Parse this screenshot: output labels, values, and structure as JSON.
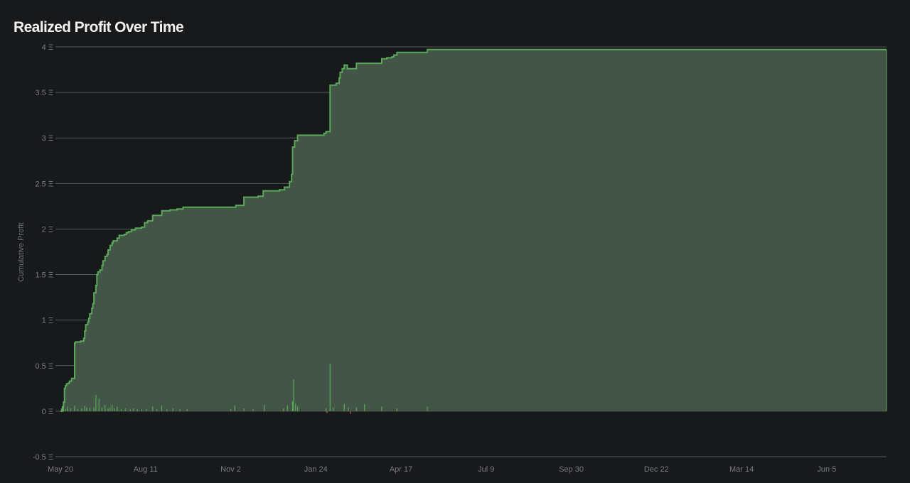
{
  "colors": {
    "background": "#18191b",
    "grid": "#55585c",
    "line": "#5aa85a",
    "area": "#435547",
    "negative": "#c25555"
  },
  "chart_data": {
    "type": "area",
    "title": "Realized Profit Over Time",
    "ylabel": "Cumulative Profit",
    "xlabel": "",
    "ylim": [
      -0.5,
      4
    ],
    "y_ticks": [
      "-0.5 Ξ",
      "0 Ξ",
      "0.5 Ξ",
      "1 Ξ",
      "1.5 Ξ",
      "2 Ξ",
      "2.5 Ξ",
      "3 Ξ",
      "3.5 Ξ",
      "4 Ξ"
    ],
    "x_ticks": [
      "May 20",
      "Aug 11",
      "Nov 2",
      "Jan 24",
      "Apr 17",
      "Jul 9",
      "Sep 30",
      "Dec 22",
      "Mar 14",
      "Jun 5"
    ],
    "grid": true,
    "x_tick_interval_days": 84,
    "x_range_days": [
      0,
      815
    ],
    "series": [
      {
        "type": "step-area",
        "points": [
          [
            0,
            0
          ],
          [
            2,
            0.05
          ],
          [
            3,
            0.1
          ],
          [
            4,
            0.25
          ],
          [
            5,
            0.28
          ],
          [
            6,
            0.3
          ],
          [
            8,
            0.31
          ],
          [
            9,
            0.33
          ],
          [
            11,
            0.36
          ],
          [
            13,
            0.36
          ],
          [
            14,
            0.75
          ],
          [
            15,
            0.76
          ],
          [
            20,
            0.77
          ],
          [
            23,
            0.8
          ],
          [
            24,
            0.88
          ],
          [
            25,
            0.95
          ],
          [
            27,
            0.98
          ],
          [
            28,
            1.02
          ],
          [
            29,
            1.07
          ],
          [
            31,
            1.13
          ],
          [
            32,
            1.18
          ],
          [
            33,
            1.3
          ],
          [
            35,
            1.38
          ],
          [
            36,
            1.5
          ],
          [
            37,
            1.53
          ],
          [
            39,
            1.55
          ],
          [
            41,
            1.6
          ],
          [
            42,
            1.65
          ],
          [
            44,
            1.7
          ],
          [
            46,
            1.72
          ],
          [
            47,
            1.77
          ],
          [
            49,
            1.82
          ],
          [
            51,
            1.85
          ],
          [
            52,
            1.87
          ],
          [
            55,
            1.87
          ],
          [
            56,
            1.9
          ],
          [
            58,
            1.93
          ],
          [
            61,
            1.93
          ],
          [
            63,
            1.94
          ],
          [
            65,
            1.96
          ],
          [
            67,
            1.97
          ],
          [
            70,
            1.99
          ],
          [
            74,
            2.01
          ],
          [
            80,
            2.02
          ],
          [
            83,
            2.07
          ],
          [
            86,
            2.09
          ],
          [
            91,
            2.15
          ],
          [
            100,
            2.2
          ],
          [
            108,
            2.21
          ],
          [
            115,
            2.22
          ],
          [
            121,
            2.24
          ],
          [
            152,
            2.24
          ],
          [
            168,
            2.24
          ],
          [
            173,
            2.26
          ],
          [
            181,
            2.35
          ],
          [
            195,
            2.36
          ],
          [
            200,
            2.42
          ],
          [
            216,
            2.43
          ],
          [
            221,
            2.46
          ],
          [
            226,
            2.52
          ],
          [
            228,
            2.6
          ],
          [
            229,
            2.9
          ],
          [
            231,
            2.97
          ],
          [
            234,
            3.03
          ],
          [
            260,
            3.05
          ],
          [
            262,
            3.07
          ],
          [
            266,
            3.58
          ],
          [
            272,
            3.6
          ],
          [
            275,
            3.66
          ],
          [
            276,
            3.72
          ],
          [
            278,
            3.76
          ],
          [
            280,
            3.8
          ],
          [
            283,
            3.76
          ],
          [
            292,
            3.82
          ],
          [
            317,
            3.87
          ],
          [
            322,
            3.88
          ],
          [
            327,
            3.89
          ],
          [
            329,
            3.91
          ],
          [
            332,
            3.94
          ],
          [
            361,
            3.94
          ],
          [
            362,
            3.97
          ],
          [
            815,
            3.97
          ]
        ]
      },
      {
        "type": "bars",
        "values": [
          [
            1,
            0.03
          ],
          [
            3,
            0.06
          ],
          [
            5,
            0.02
          ],
          [
            7,
            0.05
          ],
          [
            10,
            0.03
          ],
          [
            14,
            0.06
          ],
          [
            17,
            0.02
          ],
          [
            21,
            0.03
          ],
          [
            24,
            0.06
          ],
          [
            26,
            0.04
          ],
          [
            29,
            0.04
          ],
          [
            33,
            0.04
          ],
          [
            35,
            0.18
          ],
          [
            38,
            0.14
          ],
          [
            41,
            0.04
          ],
          [
            44,
            0.07
          ],
          [
            47,
            0.03
          ],
          [
            49,
            0.04
          ],
          [
            51,
            0.07
          ],
          [
            53,
            0.03
          ],
          [
            56,
            0.05
          ],
          [
            60,
            0.02
          ],
          [
            64,
            0.03
          ],
          [
            69,
            0.02
          ],
          [
            72,
            0.03
          ],
          [
            76,
            0.02
          ],
          [
            80,
            0.02
          ],
          [
            85,
            0.02
          ],
          [
            91,
            0.05
          ],
          [
            95,
            0.02
          ],
          [
            100,
            0.06
          ],
          [
            105,
            0.02
          ],
          [
            111,
            0.03
          ],
          [
            118,
            0.02
          ],
          [
            125,
            0.02
          ],
          [
            168,
            0.02
          ],
          [
            172,
            0.06
          ],
          [
            181,
            0.03
          ],
          [
            190,
            0.02
          ],
          [
            201,
            0.07
          ],
          [
            220,
            0.03
          ],
          [
            224,
            0.06
          ],
          [
            229,
            0.11
          ],
          [
            230,
            0.35
          ],
          [
            232,
            0.08
          ],
          [
            234,
            0.05
          ],
          [
            262,
            0.03
          ],
          [
            266,
            0.52
          ],
          [
            269,
            0.04
          ],
          [
            280,
            0.08
          ],
          [
            284,
            0.04
          ],
          [
            292,
            0.04
          ],
          [
            300,
            0.08
          ],
          [
            317,
            0.05
          ],
          [
            332,
            0.03
          ],
          [
            362,
            0.05
          ],
          [
            263,
            -0.02
          ],
          [
            286,
            -0.03
          ]
        ]
      }
    ]
  }
}
